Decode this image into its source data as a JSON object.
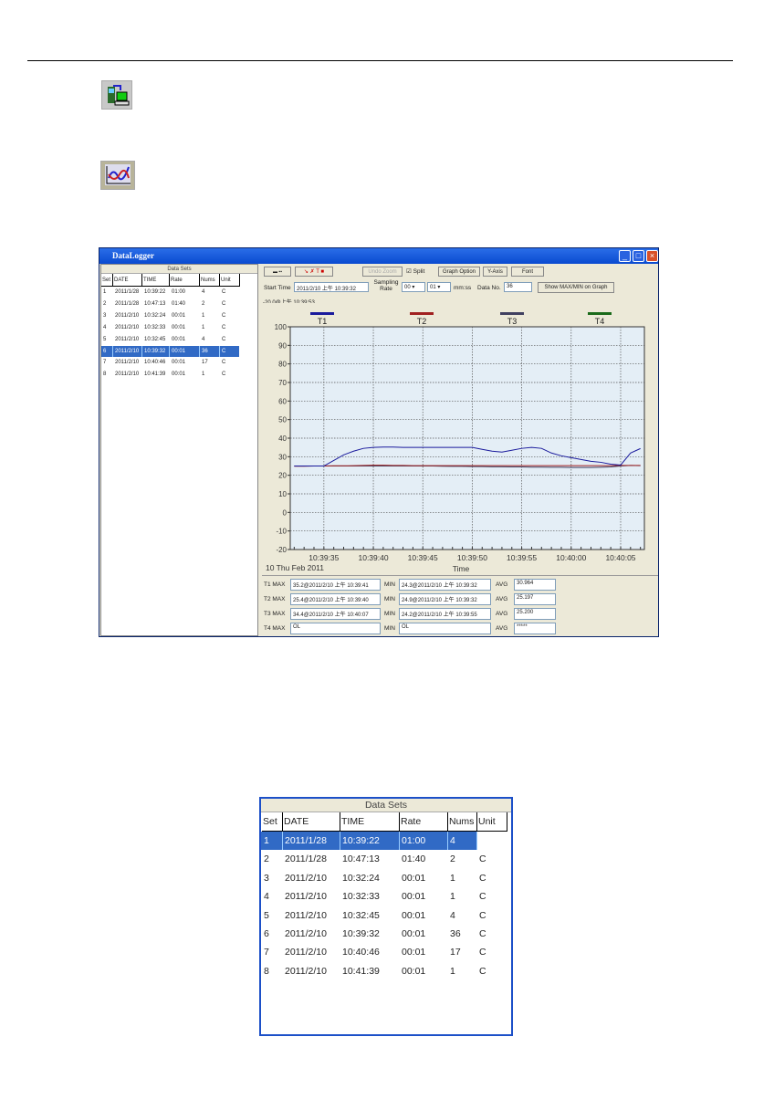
{
  "app": {
    "title": "DataLogger",
    "minimize": "_",
    "maximize": "□",
    "close": "×"
  },
  "data_sets": {
    "title": "Data Sets",
    "columns": [
      "Set",
      "DATE",
      "TIME",
      "Rate",
      "Nums",
      "Unit"
    ],
    "rows": [
      [
        "1",
        "2011/1/28",
        "10:39:22",
        "01:00",
        "4",
        "C"
      ],
      [
        "2",
        "2011/1/28",
        "10:47:13",
        "01:40",
        "2",
        "C"
      ],
      [
        "3",
        "2011/2/10",
        "10:32:24",
        "00:01",
        "1",
        "C"
      ],
      [
        "4",
        "2011/2/10",
        "10:32:33",
        "00:01",
        "1",
        "C"
      ],
      [
        "5",
        "2011/2/10",
        "10:32:45",
        "00:01",
        "4",
        "C"
      ],
      [
        "6",
        "2011/2/10",
        "10:39:32",
        "00:01",
        "36",
        "C"
      ],
      [
        "7",
        "2011/2/10",
        "10:40:46",
        "00:01",
        "17",
        "C"
      ],
      [
        "8",
        "2011/2/10",
        "10:41:39",
        "00:01",
        "1",
        "C"
      ]
    ],
    "selected_row_main": 6,
    "selected_row_zoomed": 1
  },
  "toolbar": {
    "undo_zoom": "Undo Zoom",
    "split": "Split",
    "split_checked": true,
    "graph_option": "Graph Option",
    "y_axis": "Y-Axis",
    "font": "Font",
    "start_time_label": "Start Time",
    "start_time": "2011/2/10 上午 10:39:32",
    "sampling_rate_label": "Sampling Rate",
    "rate_mm": "00",
    "rate_ss": "01",
    "rate_unit": "mm:ss",
    "data_no_label": "Data No.",
    "data_no": "36",
    "show_maxmin": "Show MAX/MIN on Graph"
  },
  "cursor_readout": "-20.0@上午 10:39:53",
  "chart_data": {
    "type": "line",
    "xlabel": "Time",
    "date_label": "10 Thu Feb 2011",
    "x_start": "10:39:32",
    "x_step_seconds": 1,
    "x_ticks": [
      "10:39:35",
      "10:39:40",
      "10:39:45",
      "10:39:50",
      "10:39:55",
      "10:40:00",
      "10:40:05"
    ],
    "ylim": [
      -20,
      100
    ],
    "y_ticks": [
      100,
      90,
      80,
      70,
      60,
      50,
      40,
      30,
      20,
      10,
      0,
      -10,
      -20
    ],
    "grid": true,
    "legend_placement": "top",
    "series": [
      {
        "name": "T1",
        "color": "#1a1a9c",
        "values": [
          25,
          25,
          25,
          25,
          28,
          31,
          33,
          34.5,
          35,
          35.2,
          35.2,
          35,
          35,
          35,
          35,
          35,
          35,
          35,
          35,
          34,
          33,
          32.5,
          33.5,
          34.5,
          35,
          34.5,
          32,
          30.5,
          29.5,
          28.5,
          27.5,
          27,
          26,
          25.5,
          32,
          34.4
        ]
      },
      {
        "name": "T2",
        "color": "#a02020",
        "values": [
          24.9,
          24.9,
          25,
          25,
          25.1,
          25.1,
          25.2,
          25.3,
          25.4,
          25.4,
          25.3,
          25.3,
          25.2,
          25.2,
          25.2,
          25.2,
          25.2,
          25.2,
          25.2,
          25.2,
          25.2,
          25.2,
          25.2,
          25.2,
          25.2,
          25.2,
          25.2,
          25.2,
          25.2,
          25.2,
          25.2,
          25.2,
          25.2,
          25.3,
          25.3,
          25.3
        ]
      },
      {
        "name": "T3",
        "color": "#404060",
        "values": [
          25,
          25,
          25,
          25,
          25,
          25,
          25,
          25,
          25,
          25,
          25,
          25,
          25,
          25,
          25,
          24.9,
          24.8,
          24.8,
          24.7,
          24.7,
          24.6,
          24.6,
          24.5,
          24.5,
          24.4,
          24.4,
          24.3,
          24.3,
          24.2,
          24.2,
          24.2,
          24.3,
          24.5,
          25,
          25.3,
          25.2
        ]
      },
      {
        "name": "T4",
        "color": "#1a6a1a",
        "values": []
      }
    ]
  },
  "stats": [
    {
      "max_label": "T1 MAX",
      "max": "35.2@2011/2/10 上午 10:39:41",
      "min_label": "MIN",
      "min": "24.3@2011/2/10 上午 10:39:32",
      "avg_label": "AVG",
      "avg": "30.964"
    },
    {
      "max_label": "T2 MAX",
      "max": "25.4@2011/2/10 上午 10:39:40",
      "min_label": "MIN",
      "min": "24.9@2011/2/10 上午 10:39:32",
      "avg_label": "AVG",
      "avg": "25.197"
    },
    {
      "max_label": "T3 MAX",
      "max": "34.4@2011/2/10 上午 10:40:07",
      "min_label": "MIN",
      "min": "24.2@2011/2/10 上午 10:39:55",
      "avg_label": "AVG",
      "avg": "25.200"
    },
    {
      "max_label": "T4 MAX",
      "max": "OL",
      "min_label": "MIN",
      "min": "OL",
      "avg_label": "AVG",
      "avg": "*****"
    }
  ]
}
